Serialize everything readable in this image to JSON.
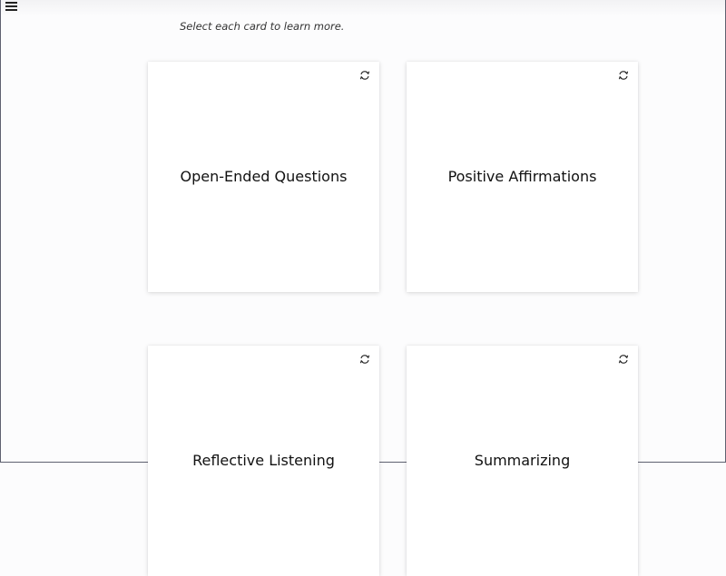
{
  "instruction": "Select each card to learn more.",
  "cards": [
    {
      "title": "Open-Ended Questions",
      "icon": "flip-icon"
    },
    {
      "title": "Positive Affirmations",
      "icon": "flip-icon"
    },
    {
      "title": "Reflective Listening",
      "icon": "flip-icon"
    },
    {
      "title": "Summarizing",
      "icon": "flip-icon"
    }
  ],
  "menu": {
    "icon": "hamburger-menu-icon"
  }
}
